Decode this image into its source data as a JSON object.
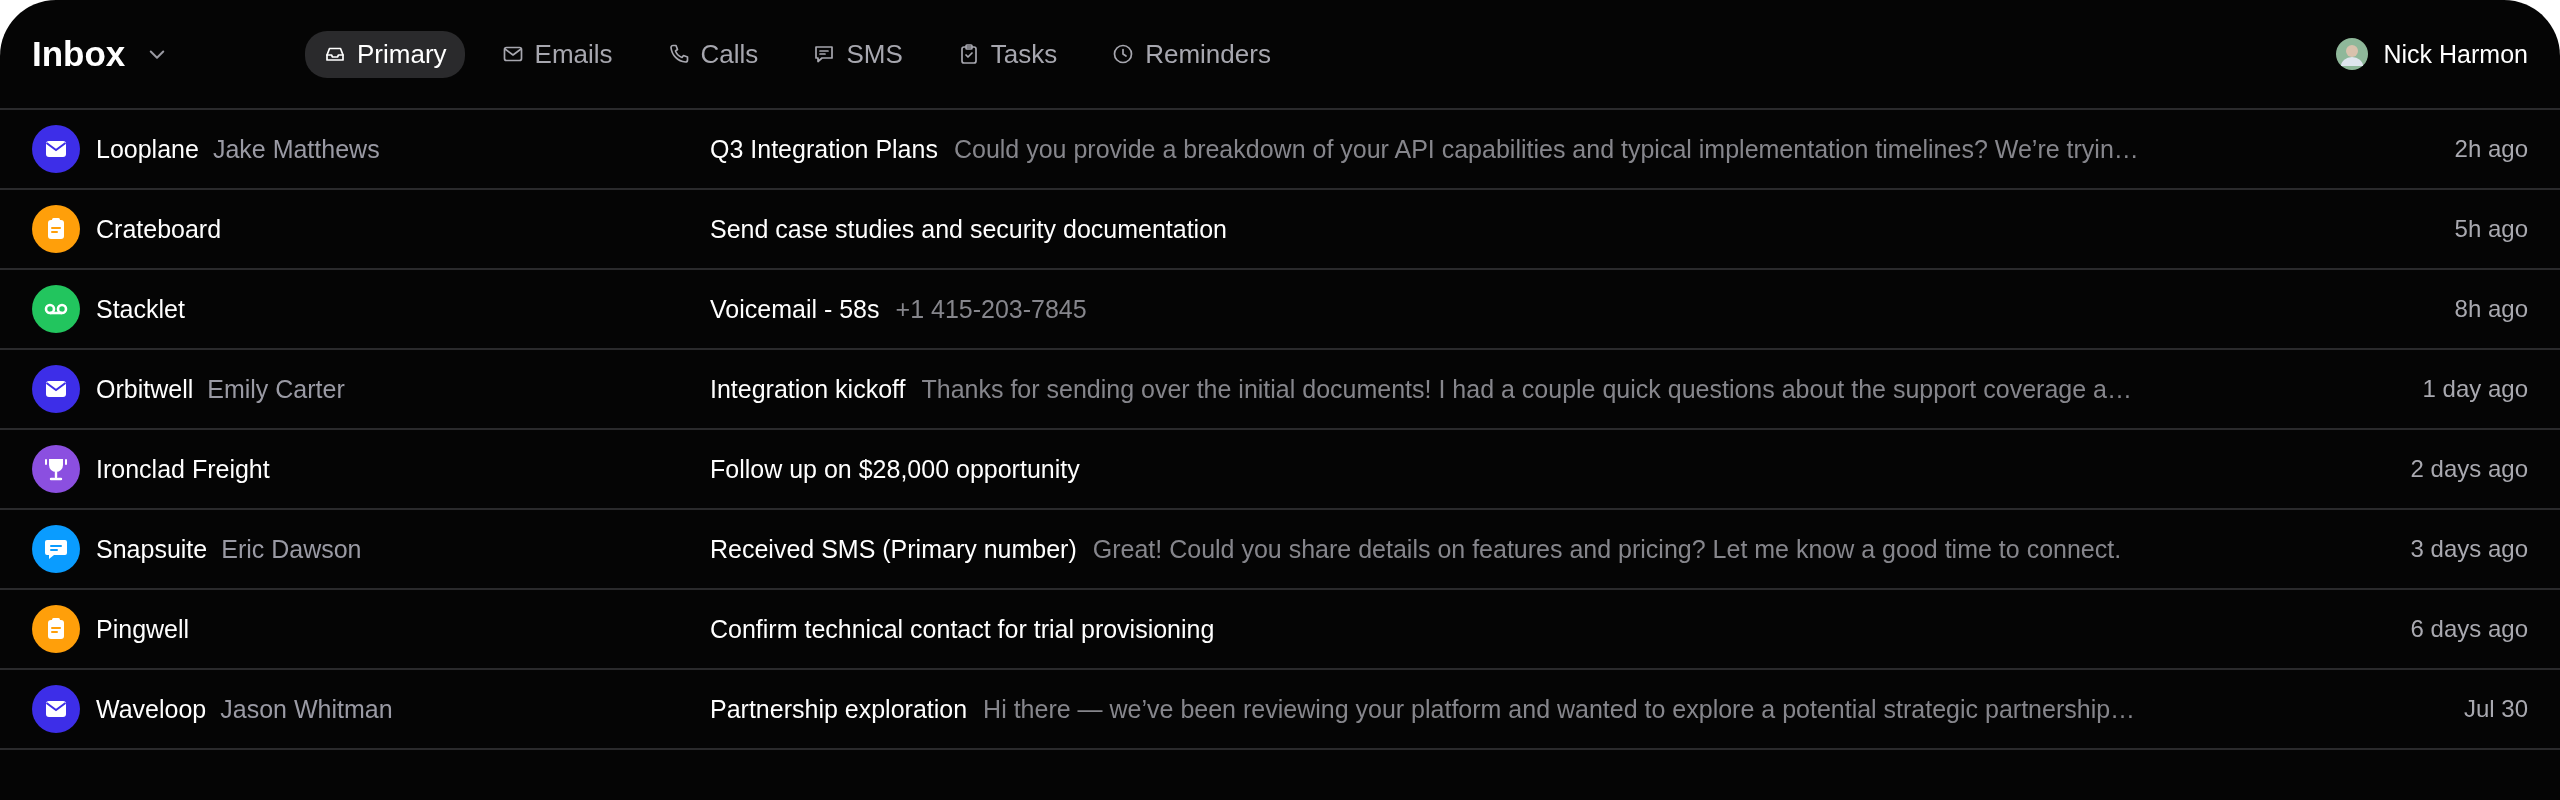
{
  "header": {
    "title": "Inbox",
    "tabs": [
      {
        "label": "Primary",
        "kind": "inbox",
        "selected": true
      },
      {
        "label": "Emails",
        "kind": "mail",
        "selected": false
      },
      {
        "label": "Calls",
        "kind": "phone",
        "selected": false
      },
      {
        "label": "SMS",
        "kind": "chat",
        "selected": false
      },
      {
        "label": "Tasks",
        "kind": "clipboard",
        "selected": false
      },
      {
        "label": "Reminders",
        "kind": "clock",
        "selected": false
      }
    ],
    "user": {
      "name": "Nick Harmon"
    }
  },
  "rows": [
    {
      "kind": "email",
      "company": "Looplane",
      "contact": "Jake Matthews",
      "subject": "Q3 Integration Plans",
      "preview": "Could you provide a breakdown of your API capabilities and typical implementation timelines? We’re tryin…",
      "time": "2h ago"
    },
    {
      "kind": "task",
      "company": "Crateboard",
      "subject": "Send case studies and security documentation",
      "time": "5h ago"
    },
    {
      "kind": "voicemail",
      "company": "Stacklet",
      "subject": "Voicemail - 58s",
      "preview": "+1 415-203-7845",
      "time": "8h ago"
    },
    {
      "kind": "email",
      "company": "Orbitwell",
      "contact": "Emily Carter",
      "subject": "Integration kickoff",
      "preview": "Thanks for sending over the initial documents! I had a couple quick questions about the support coverage a…",
      "time": "1 day ago"
    },
    {
      "kind": "deal",
      "company": "Ironclad Freight",
      "subject": "Follow up on $28,000 opportunity",
      "time": "2 days ago"
    },
    {
      "kind": "sms",
      "company": "Snapsuite",
      "contact": "Eric Dawson",
      "subject": "Received SMS (Primary number)",
      "preview": "Great! Could you share details on features and pricing? Let me know a good time to connect.",
      "time": "3 days ago"
    },
    {
      "kind": "task",
      "company": "Pingwell",
      "subject": "Confirm technical contact for trial provisioning",
      "time": "6 days ago"
    },
    {
      "kind": "email",
      "company": "Waveloop",
      "contact": "Jason Whitman",
      "subject": "Partnership exploration",
      "preview": "Hi there — we’ve been reviewing your platform and wanted to explore a potential strategic partnership…",
      "time": "Jul 30"
    }
  ]
}
